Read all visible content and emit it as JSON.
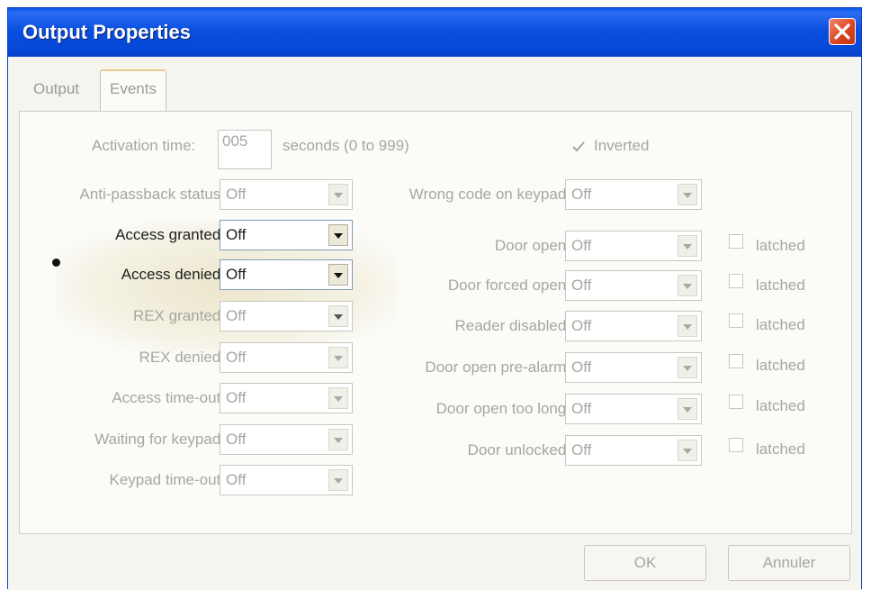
{
  "window": {
    "title": "Output Properties"
  },
  "tabs": {
    "output": "Output",
    "events": "Events"
  },
  "activation": {
    "label": "Activation time:",
    "value": "005",
    "suffix": "seconds (0 to 999)"
  },
  "inverted": {
    "label": "Inverted",
    "checked": true
  },
  "left_fields": [
    {
      "label": "Anti-passback status:",
      "value": "Off"
    },
    {
      "label": "Access granted:",
      "value": "Off"
    },
    {
      "label": "Access denied:",
      "value": "Off"
    },
    {
      "label": "REX granted:",
      "value": "Off"
    },
    {
      "label": "REX denied:",
      "value": "Off"
    },
    {
      "label": "Access time-out:",
      "value": "Off"
    },
    {
      "label": "Waiting for keypad:",
      "value": "Off"
    },
    {
      "label": "Keypad time-out:",
      "value": "Off"
    }
  ],
  "right_fields": [
    {
      "label": "Wrong code on keypad:",
      "value": "Off"
    },
    {
      "label": "Door open:",
      "value": "Off",
      "latched": "latched"
    },
    {
      "label": "Door forced open:",
      "value": "Off",
      "latched": "latched"
    },
    {
      "label": "Reader disabled:",
      "value": "Off",
      "latched": "latched"
    },
    {
      "label": "Door open pre-alarm:",
      "value": "Off",
      "latched": "latched"
    },
    {
      "label": "Door open too long:",
      "value": "Off",
      "latched": "latched"
    },
    {
      "label": "Door unlocked:",
      "value": "Off",
      "latched": "latched"
    }
  ],
  "buttons": {
    "ok": "OK",
    "cancel": "Annuler"
  }
}
